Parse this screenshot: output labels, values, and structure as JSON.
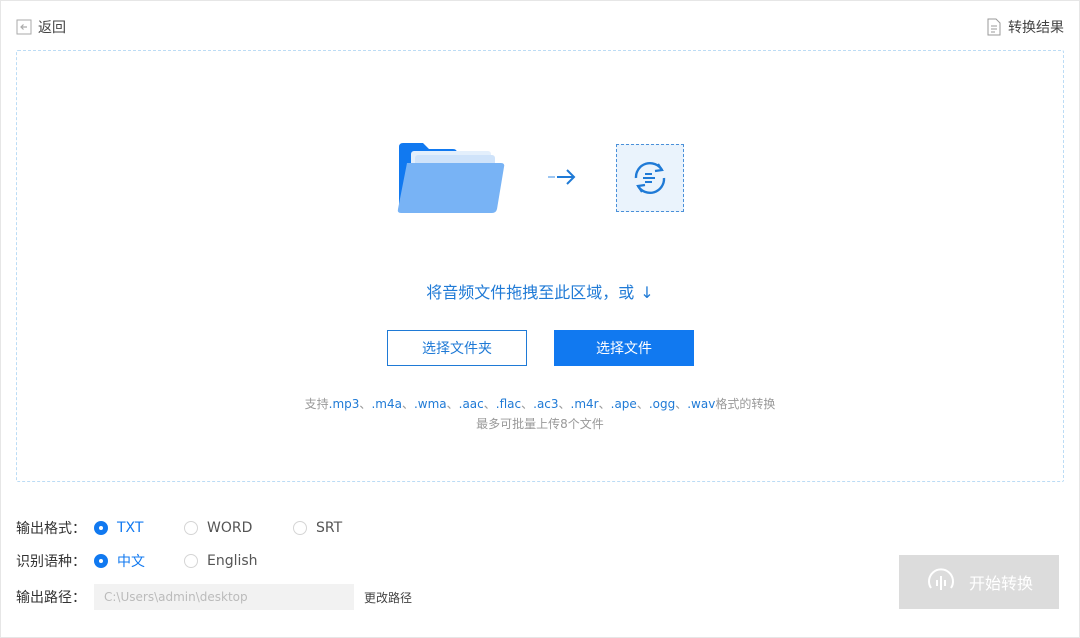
{
  "header": {
    "back_label": "返回",
    "results_label": "转换结果"
  },
  "dropzone": {
    "prompt": "将音频文件拖拽至此区域，或",
    "select_folder": "选择文件夹",
    "select_file": "选择文件",
    "support_prefix": "支持",
    "formats": [
      ".mp3",
      ".m4a",
      ".wma",
      ".aac",
      ".flac",
      ".ac3",
      ".m4r",
      ".ape",
      ".ogg",
      ".wav"
    ],
    "support_suffix": "格式的转换",
    "limit_text": "最多可批量上传8个文件"
  },
  "options": {
    "format": {
      "label": "输出格式：",
      "choices": [
        "TXT",
        "WORD",
        "SRT"
      ],
      "selected": "TXT"
    },
    "language": {
      "label": "识别语种：",
      "choices": [
        "中文",
        "English"
      ],
      "selected": "中文"
    },
    "path": {
      "label": "输出路径：",
      "placeholder": "C:\\Users\\admin\\desktop",
      "change_label": "更改路径"
    }
  },
  "start_button": {
    "label": "开始转换"
  },
  "colors": {
    "accent": "#1179f0",
    "disabled": "#dcdcdc",
    "dropzone_border": "#bcdcf5"
  },
  "icons": [
    "back-icon",
    "document-icon",
    "folder-icon",
    "arrow-right-icon",
    "convert-icon",
    "arrow-down-icon",
    "waveform-icon"
  ]
}
